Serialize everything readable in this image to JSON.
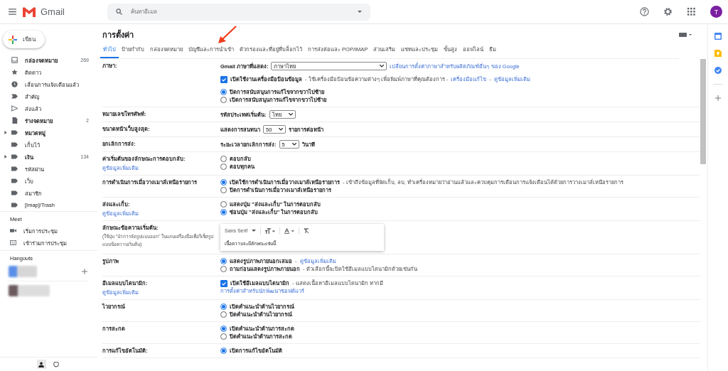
{
  "header": {
    "app_name": "Gmail",
    "search": {
      "placeholder": "ค้นหาอีเมล"
    },
    "avatar": "T"
  },
  "sidebar": {
    "compose": "เขียน",
    "items": [
      {
        "kind": "inbox",
        "label": "กล่องจดหมาย",
        "count": "269",
        "unread": true,
        "collapsed": false
      },
      {
        "kind": "starred",
        "label": "ติดดาว",
        "unread": false,
        "collapsed": false
      },
      {
        "kind": "snoozed",
        "label": "เลื่อนการแจ้งเตือนแล้ว",
        "unread": false,
        "collapsed": false
      },
      {
        "kind": "important",
        "label": "สำคัญ",
        "unread": false,
        "collapsed": false
      },
      {
        "kind": "sent",
        "label": "ส่งแล้ว",
        "unread": false,
        "collapsed": false
      },
      {
        "kind": "draft",
        "label": "ร่างจดหมาย",
        "count": "2",
        "unread": true,
        "collapsed": false
      },
      {
        "kind": "label",
        "label": "หมวดหมู่",
        "unread": true,
        "collapsed": true
      },
      {
        "kind": "label",
        "label": "เก็บไว้",
        "unread": false,
        "collapsed": false
      },
      {
        "kind": "label",
        "label": "เงิน",
        "count": "134",
        "unread": true,
        "collapsed": true
      },
      {
        "kind": "label",
        "label": "รหัสผ่าน",
        "unread": false,
        "collapsed": false
      },
      {
        "kind": "label",
        "label": "เว็บ",
        "unread": false,
        "collapsed": false
      },
      {
        "kind": "label",
        "label": "สมาชิก",
        "unread": false,
        "collapsed": false
      },
      {
        "kind": "label",
        "label": "[Imap]/Trash",
        "unread": false,
        "collapsed": false
      }
    ],
    "meet": {
      "title": "Meet",
      "items": [
        {
          "kind": "video",
          "label": "เริ่มการประชุม"
        },
        {
          "kind": "keyboard",
          "label": "เข้าร่วมการประชุม"
        }
      ]
    },
    "hangouts": {
      "title": "Hangouts"
    }
  },
  "settings": {
    "title": "การตั้งค่า",
    "tabs": [
      {
        "label": "ทั่วไป",
        "selected": true
      },
      {
        "label": "ป้ายกำกับ",
        "selected": false
      },
      {
        "label": "กล่องจดหมาย",
        "selected": false
      },
      {
        "label": "บัญชีและการนำเข้า",
        "selected": false
      },
      {
        "label": "ตัวกรองและที่อยู่ที่บล็อกไว้",
        "selected": false
      },
      {
        "label": "การส่งต่อและ POP/IMAP",
        "selected": false
      },
      {
        "label": "ส่วนเสริม",
        "selected": false
      },
      {
        "label": "แชทและประชุม",
        "selected": false
      },
      {
        "label": "ขั้นสูง",
        "selected": false
      },
      {
        "label": "ออฟไลน์",
        "selected": false
      },
      {
        "label": "ธีม",
        "selected": false
      }
    ],
    "rows": [
      {
        "label": "ภาษา:",
        "controls": [
          {
            "kind": "select",
            "label": "Gmail ภาษาที่แสดง:",
            "value": "ภาษาไทย",
            "parts": [
              {
                "text": "เปลี่ยนการตั้งค่าภาษาสำหรับผลิตภัณฑ์อื่นๆ ของ Google",
                "link": true
              }
            ]
          },
          {
            "kind": "checkbox",
            "checked": true,
            "label": "เปิดใช้งานเครื่องมือป้อนข้อมูล",
            "parts": [
              {
                "text": " - ใช้เครื่องมือป้อนข้อความต่างๆ เพื่อพิมพ์ภาษาที่คุณต้องการ - ",
                "link": false
              },
              {
                "text": "เครื่องมือแก้ไข",
                "link": true
              },
              {
                "text": " - ",
                "link": false
              },
              {
                "text": "ดูข้อมูลเพิ่มเติม",
                "link": true
              }
            ]
          },
          {
            "kind": "radio",
            "selected": true,
            "label": "ปิดการสนับสนุนการแก้ไขจากขวาไปซ้าย"
          },
          {
            "kind": "radio",
            "selected": false,
            "label": "เปิดการสนับสนุนการแก้ไขจากขวาไปซ้าย"
          }
        ]
      },
      {
        "label": "หมายเลขโทรศัพท์:",
        "controls": [
          {
            "kind": "select",
            "label": "รหัสประเทศเริ่มต้น:",
            "value": "ไทย"
          }
        ]
      },
      {
        "label": "ขนาดหน้าเว็บสูงสุด:",
        "controls": [
          {
            "kind": "select",
            "label": "แสดงการสนทนา",
            "value": "50",
            "parts": [
              {
                "text": "รายการต่อหน้า",
                "link": false
              }
            ]
          }
        ]
      },
      {
        "label": "ยกเลิกการส่ง:",
        "controls": [
          {
            "kind": "select",
            "label": "ระยะเวลายกเลิกการส่ง:",
            "value": "5",
            "parts": [
              {
                "text": "วินาที",
                "link": false
              }
            ]
          }
        ]
      },
      {
        "label": "ค่าเริ่มต้นของลักษณะการตอบกลับ:",
        "link": "ดูข้อมูลเพิ่มเติม",
        "controls": [
          {
            "kind": "radio",
            "selected": false,
            "label": "ตอบกลับ"
          },
          {
            "kind": "radio",
            "selected": false,
            "label": "ตอบทุกคน"
          }
        ]
      },
      {
        "label": "การดำเนินการเมื่อวางเมาส์เหนือรายการ",
        "controls": [
          {
            "kind": "radio",
            "selected": true,
            "label": "เปิดใช้การดำเนินการเมื่อวางเมาส์เหนือรายการ",
            "parts": [
              {
                "text": " - เข้าถึงข้อมูลที่จัดเก็บ, ลบ, ทำเครื่องหมายว่าอ่านแล้วและควบคุมการเตือนการแจ้งเตือนได้ด้วยการวางเมาส์เหนือรายการ",
                "link": false
              }
            ]
          },
          {
            "kind": "radio",
            "selected": false,
            "label": "ปิดการดำเนินการเมื่อวางเมาส์เหนือรายการ"
          }
        ]
      },
      {
        "label": "ส่งและเก็บ:",
        "link": "ดูข้อมูลเพิ่มเติม",
        "controls": [
          {
            "kind": "radio",
            "selected": false,
            "label": "แสดงปุ่ม \"ส่งและเก็บ\" ในการตอบกลับ"
          },
          {
            "kind": "radio",
            "selected": true,
            "label": "ซ่อนปุ่ม \"ส่งและเก็บ\" ในการตอบกลับ"
          }
        ]
      },
      {
        "label": "ลักษณะข้อความเริ่มต้น:",
        "note": "(ใช้ปุ่ม \"นำการจัดรูปแบบออก\" ในแถบเครื่องมือเพื่อรีเซ็ตรูปแบบข้อความเริ่มต้น)",
        "controls": [
          {
            "kind": "editor",
            "font": "Sans Serif",
            "preview": "เนื้อความจะมีลักษณะเช่นนี้"
          }
        ]
      },
      {
        "label": "รูปภาพ",
        "controls": [
          {
            "kind": "radio",
            "selected": true,
            "label": "แสดงรูปภาพภายนอกเสมอ",
            "parts": [
              {
                "text": " - ",
                "link": false
              },
              {
                "text": "ดูข้อมูลเพิ่มเติม",
                "link": true
              }
            ]
          },
          {
            "kind": "radio",
            "selected": false,
            "label": "ถามก่อนแสดงรูปภาพภายนอก",
            "parts": [
              {
                "text": " - ตัวเลือกนี้จะปิดใช้อีเมลแบบไดนามิกด้วยเช่นกัน",
                "link": false
              }
            ]
          }
        ]
      },
      {
        "label": "อีเมลแบบไดนามิก:",
        "link": "ดูข้อมูลเพิ่มเติม",
        "controls": [
          {
            "kind": "checkbox",
            "checked": true,
            "label": "เปิดใช้อีเมลแบบไดนามิก",
            "parts": [
              {
                "text": " - แสดงเนื้อหาอีเมลแบบไดนามิก หากมี",
                "link": false
              }
            ]
          },
          {
            "kind": "link",
            "parts": [
              {
                "text": "การตั้งค่าสำหรับนักพัฒนาซอฟต์แวร์",
                "link": true
              }
            ]
          }
        ]
      },
      {
        "label": "ไวยากรณ์",
        "controls": [
          {
            "kind": "radio",
            "selected": true,
            "label": "เปิดคำแนะนำด้านไวยากรณ์"
          },
          {
            "kind": "radio",
            "selected": false,
            "label": "ปิดคำแนะนำด้านไวยากรณ์"
          }
        ]
      },
      {
        "label": "การสะกด",
        "controls": [
          {
            "kind": "radio",
            "selected": true,
            "label": "เปิดคำแนะนำด้านการสะกด"
          },
          {
            "kind": "radio",
            "selected": false,
            "label": "ปิดคำแนะนำด้านการสะกด"
          }
        ]
      },
      {
        "label": "การแก้ไขอัตโนมัติ:",
        "controls": [
          {
            "kind": "radio",
            "selected": true,
            "label": "เปิดการแก้ไขอัตโนมัติ"
          }
        ]
      }
    ]
  }
}
